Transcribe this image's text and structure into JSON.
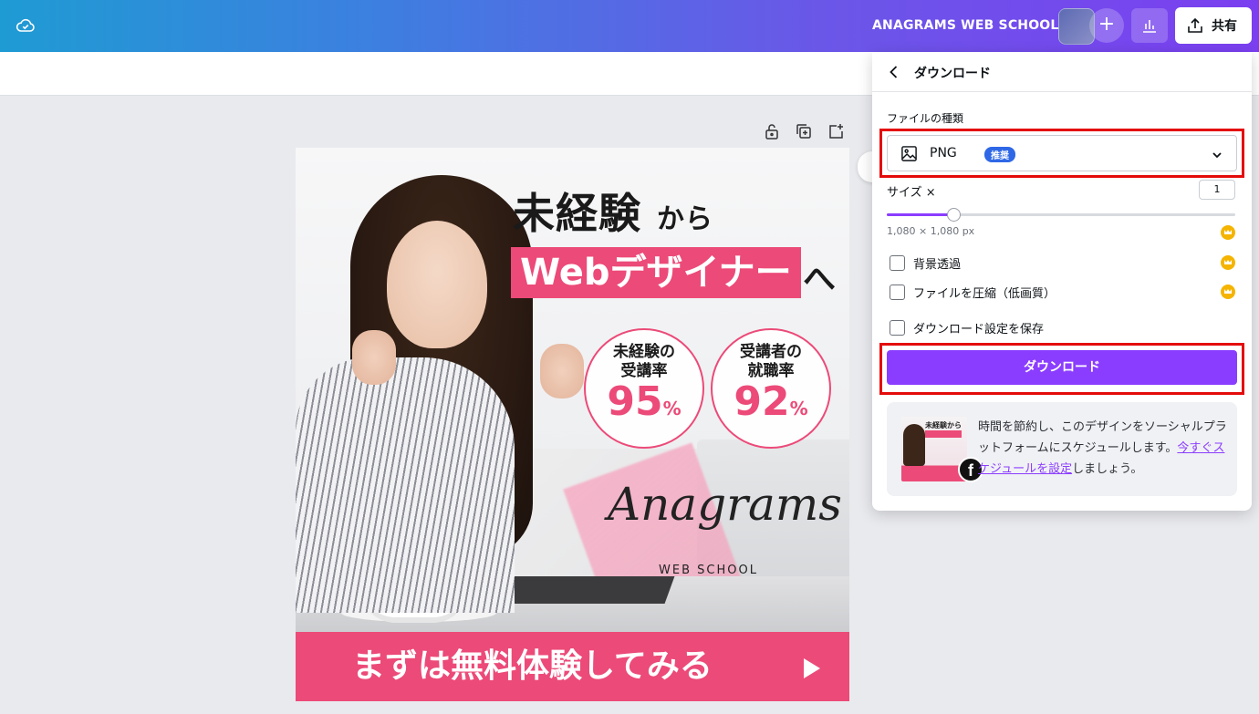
{
  "topbar": {
    "brand": "ANAGRAMS WEB SCHOOL",
    "share_label": "共有",
    "colors": {
      "gradient_start": "#1f9bd3",
      "gradient_end": "#7b3ff0"
    }
  },
  "icons": {
    "cloud": "cloud-saved-icon",
    "plus": "plus-icon",
    "stats": "bar-chart-icon",
    "share": "upload-icon",
    "lock": "lock-icon",
    "duplicate": "duplicate-icon",
    "add_page": "add-page-icon",
    "image": "image-icon",
    "chevron": "chevron-down-icon",
    "crown": "crown-icon",
    "facebook": "facebook-icon"
  },
  "design": {
    "headline1_main": "未経験",
    "headline1_tail": "から",
    "headline2": "Webデザイナー",
    "headline2_tail": "へ",
    "stats": [
      {
        "label": "未経験の\n受講率",
        "value": "95",
        "unit": "%"
      },
      {
        "label": "受講者の\n就職率",
        "value": "92",
        "unit": "%"
      }
    ],
    "logo_script": "Anagrams",
    "logo_sub": "WEB SCHOOL",
    "cta": "まずは無料体験してみる",
    "accent": "#ec4a78"
  },
  "download_panel": {
    "title": "ダウンロード",
    "filetype_label": "ファイルの種類",
    "filetype_value": "PNG",
    "recommended_badge": "推奨",
    "size_label": "サイズ ×",
    "size_value": "1",
    "size_slider_fraction": 0.19,
    "dimensions": "1,080 × 1,080 px",
    "options": [
      {
        "label": "背景透過",
        "checked": false,
        "pro": true
      },
      {
        "label": "ファイルを圧縮（低画質）",
        "checked": false,
        "pro": true
      },
      {
        "label": "ダウンロード設定を保存",
        "checked": false,
        "pro": false
      }
    ],
    "download_button": "ダウンロード",
    "promo_text_1": "時間を節約し、このデザインをソーシャルプラットフォームにスケジュールします。",
    "promo_link": "今すぐスケジュールを設定",
    "promo_text_2": "しましょう。",
    "promo_thumb_title": "未経験から",
    "button_color": "#8b3dff",
    "highlight_color": "#e40b0b"
  }
}
